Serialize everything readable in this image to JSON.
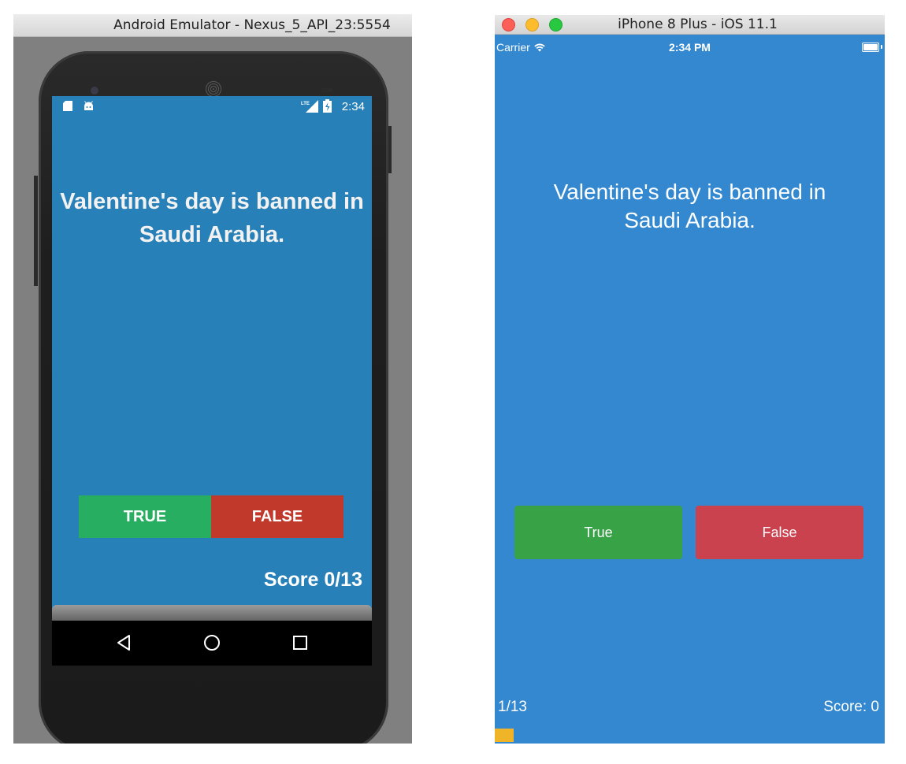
{
  "android": {
    "window_title": "Android Emulator - Nexus_5_API_23:5554",
    "status": {
      "time": "2:34",
      "network": "LTE"
    },
    "question": "Valentine's day is banned in Saudi Arabia.",
    "true_label": "TRUE",
    "false_label": "FALSE",
    "score_label": "Score 0/13",
    "nav_icons": [
      "back-icon",
      "home-icon",
      "recents-icon"
    ],
    "colors": {
      "background": "#2880b9",
      "true": "#27ae60",
      "false": "#c0392b"
    }
  },
  "ios": {
    "window_title": "iPhone 8 Plus - iOS 11.1",
    "status": {
      "carrier": "Carrier",
      "time": "2:34 PM"
    },
    "question": "Valentine's day is banned in Saudi Arabia.",
    "true_label": "True",
    "false_label": "False",
    "progress_label": "1/13",
    "score_label": "Score: 0",
    "progress_fraction": 0.048,
    "colors": {
      "background": "#3388d0",
      "true": "#38a246",
      "false": "#c9424d",
      "progress": "#f0b429"
    }
  }
}
